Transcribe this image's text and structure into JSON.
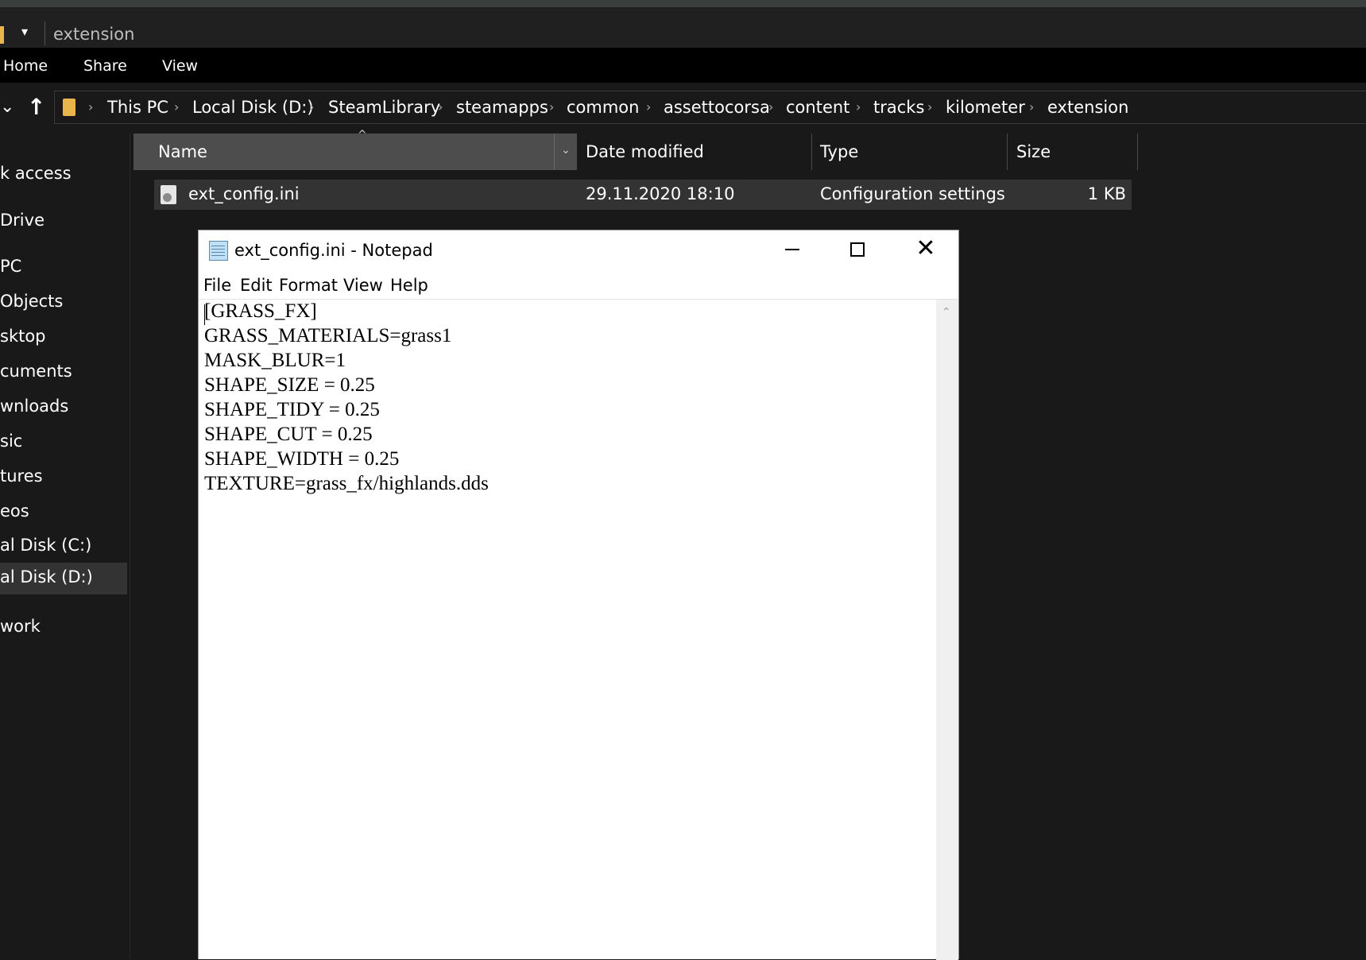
{
  "explorer": {
    "window_title": "extension",
    "qa_dropdown_glyph": "▾",
    "ribbon_tabs": [
      "Home",
      "Share",
      "View"
    ],
    "nav": {
      "expand_glyph": "⌄",
      "up_glyph": "↑"
    },
    "breadcrumbs": [
      "This PC",
      "Local Disk (D:)",
      "SteamLibrary",
      "steamapps",
      "common",
      "assettocorsa",
      "content",
      "tracks",
      "kilometer",
      "extension"
    ],
    "breadcrumb_separator": "›",
    "sidebar": {
      "items": [
        "k access",
        "Drive",
        "PC",
        "Objects",
        "sktop",
        "cuments",
        "wnloads",
        "sic",
        "tures",
        "eos",
        "al Disk (C:)",
        "al Disk (D:)",
        "work"
      ],
      "selected": "al Disk (D:)"
    },
    "columns": {
      "name": "Name",
      "date": "Date modified",
      "type": "Type",
      "size": "Size"
    },
    "sort_glyph": "^",
    "column_dropdown_glyph": "⌄",
    "files": [
      {
        "name": "ext_config.ini",
        "date": "29.11.2020 18:10",
        "type": "Configuration settings",
        "size": "1 KB",
        "icon": "ini-settings-file-icon"
      }
    ]
  },
  "notepad": {
    "title": "ext_config.ini - Notepad",
    "close_glyph": "✕",
    "scroll_up_glyph": "⌃",
    "menu": [
      "File",
      "Edit",
      "Format",
      "View",
      "Help"
    ],
    "lines": [
      "[GRASS_FX]",
      "GRASS_MATERIALS=grass1",
      "MASK_BLUR=1",
      "SHAPE_SIZE = 0.25",
      "SHAPE_TIDY = 0.25",
      "SHAPE_CUT = 0.25",
      "SHAPE_WIDTH = 0.25",
      "TEXTURE=grass_fx/highlands.dds"
    ]
  },
  "colors": {
    "explorer_bg": "#191919",
    "ribbon_bg": "#000000",
    "header_selected": "#4d4d4d",
    "row_selected": "#333333",
    "folder_yellow": "#e8b64a",
    "notepad_bg": "#ffffff"
  }
}
